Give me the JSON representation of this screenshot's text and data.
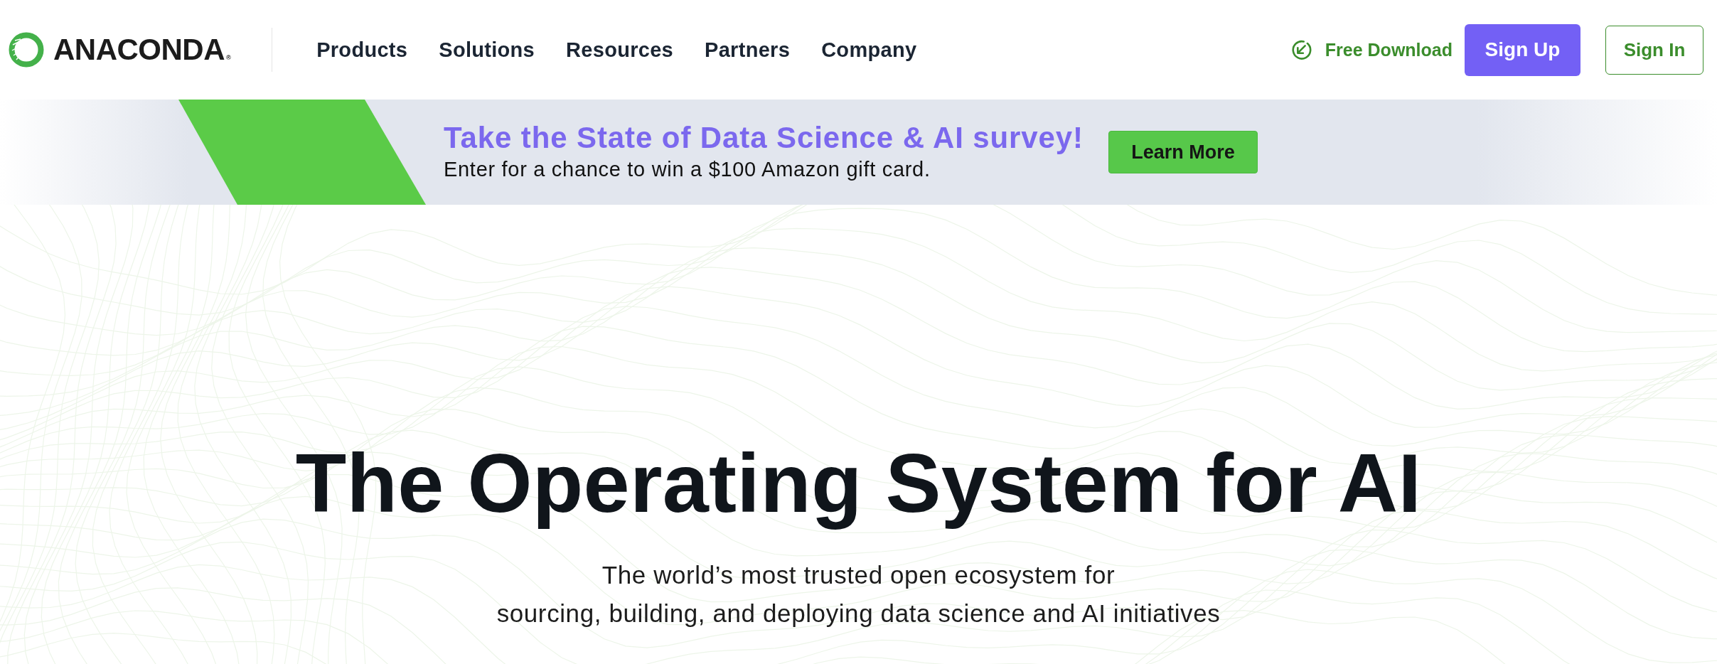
{
  "header": {
    "logo": {
      "wordmark": "ANACONDA$_{®}$"
    },
    "nav": [
      {
        "label": "Products"
      },
      {
        "label": "Solutions"
      },
      {
        "label": "Resources"
      },
      {
        "label": "Partners"
      },
      {
        "label": "Company"
      }
    ],
    "actions": [
      {
        "kind": "link",
        "label": "Free Download"
      },
      {
        "kind": "primary",
        "label": "Sign Up"
      },
      {
        "kind": "outline",
        "label": "Sign In"
      }
    ]
  },
  "banner": {
    "title": "Take the State of Data Science & AI survey!",
    "text": "Enter for a chance to win a $100 Amazon gift card.",
    "button": "Learn More"
  },
  "hero": {
    "headline": "The Operating System for AI",
    "subtitle_lines": [
      "The world’s most trusted open ecosystem for",
      "sourcing, building, and deploying data science and AI initiatives"
    ]
  }
}
